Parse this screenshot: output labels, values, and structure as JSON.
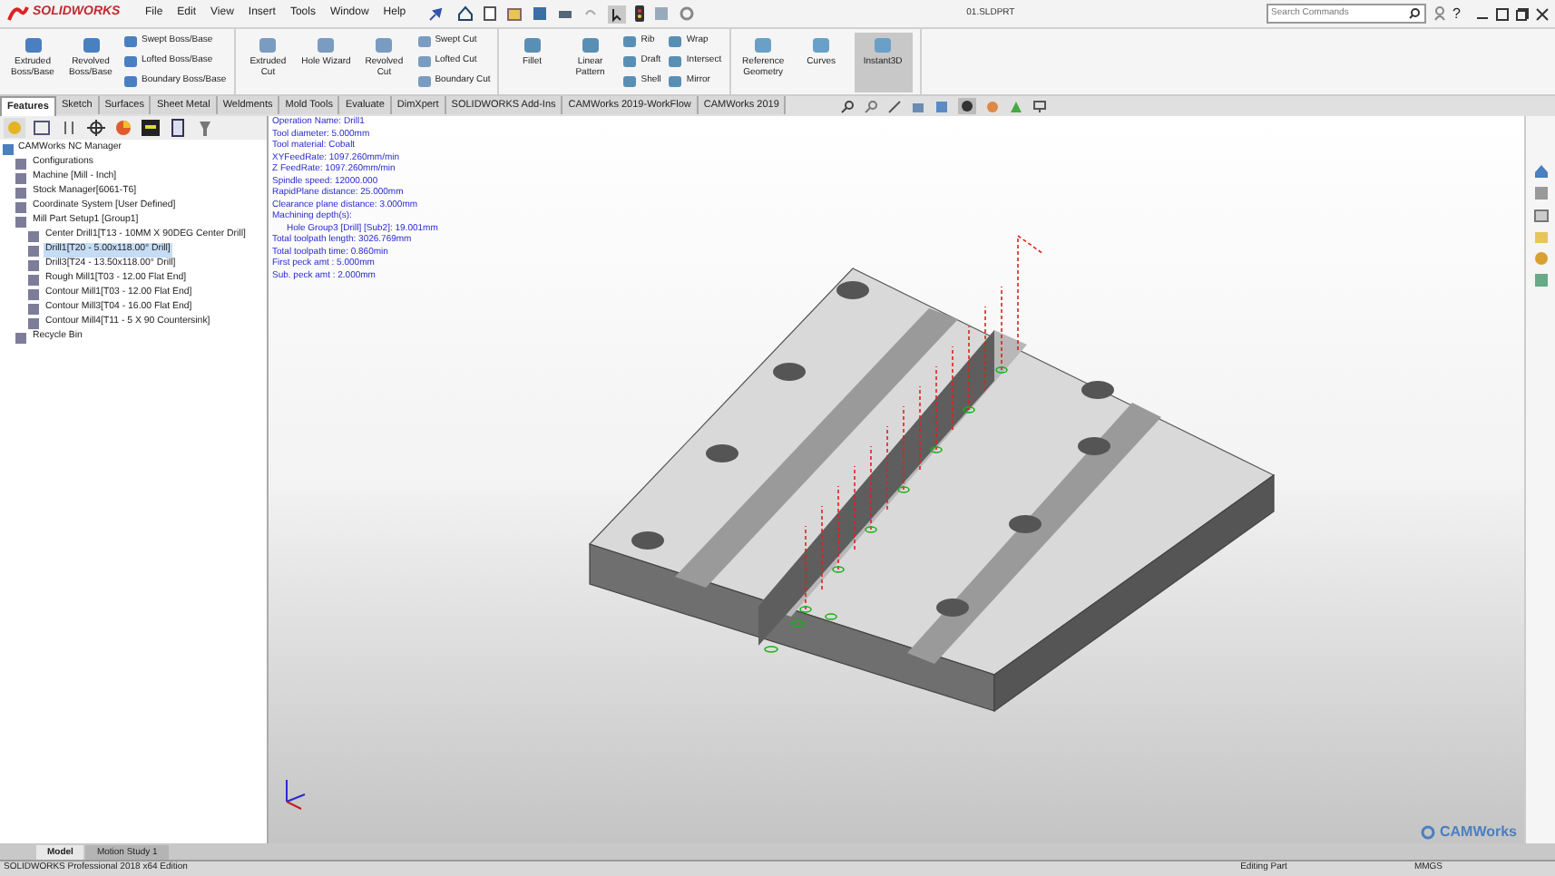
{
  "app": {
    "logo": "SOLIDWORKS",
    "menus": [
      "File",
      "Edit",
      "View",
      "Insert",
      "Tools",
      "Window",
      "Help"
    ],
    "document_title": "01.SLDPRT",
    "search": {
      "placeholder": "Search Commands"
    },
    "help": "?"
  },
  "ribbon": {
    "groups": [
      {
        "items": [
          {
            "kind": "large",
            "label": "Extruded Boss/Base",
            "on": false
          },
          {
            "kind": "large",
            "label": "Revolved Boss/Base",
            "on": false
          },
          {
            "kind": "stack",
            "labels": [
              "Swept Boss/Base",
              "Lofted Boss/Base",
              "Boundary Boss/Base"
            ]
          }
        ]
      },
      {
        "items": [
          {
            "kind": "large",
            "label": "Extruded Cut",
            "on": false
          },
          {
            "kind": "large",
            "label": "Hole Wizard",
            "on": false
          },
          {
            "kind": "large",
            "label": "Revolved Cut",
            "on": false
          },
          {
            "kind": "stack",
            "labels": [
              "Swept Cut",
              "Lofted Cut",
              "Boundary Cut"
            ]
          }
        ]
      },
      {
        "items": [
          {
            "kind": "large",
            "label": "Fillet",
            "on": false
          },
          {
            "kind": "large",
            "label": "Linear Pattern",
            "on": false
          },
          {
            "kind": "stack",
            "labels": [
              "Rib",
              "Draft",
              "Shell"
            ]
          },
          {
            "kind": "stack",
            "labels": [
              "Wrap",
              "Intersect",
              "Mirror"
            ]
          }
        ]
      },
      {
        "items": [
          {
            "kind": "large",
            "label": "Reference Geometry",
            "on": false
          },
          {
            "kind": "large",
            "label": "Curves",
            "on": false
          },
          {
            "kind": "large",
            "label": "Instant3D",
            "on": true
          }
        ]
      }
    ]
  },
  "tabs": [
    {
      "label": "Features",
      "selected": true
    },
    {
      "label": "Sketch",
      "selected": false
    },
    {
      "label": "Surfaces",
      "selected": false
    },
    {
      "label": "Sheet Metal",
      "selected": false
    },
    {
      "label": "Weldments",
      "selected": false
    },
    {
      "label": "Mold Tools",
      "selected": false
    },
    {
      "label": "Evaluate",
      "selected": false
    },
    {
      "label": "DimXpert",
      "selected": false
    },
    {
      "label": "SOLIDWORKS Add-Ins",
      "selected": false
    },
    {
      "label": "CAMWorks 2019-WorkFlow",
      "selected": false
    },
    {
      "label": "CAMWorks 2019",
      "selected": false
    }
  ],
  "tree": {
    "label": "CAMWorks NC Manager",
    "children": [
      {
        "label": "Configurations",
        "selected": false
      },
      {
        "label": "Machine [Mill - Inch]",
        "selected": false
      },
      {
        "label": "Stock Manager[6061-T6]",
        "selected": false
      },
      {
        "label": "Coordinate System [User Defined]",
        "selected": false
      },
      {
        "label": "Mill Part Setup1 [Group1]",
        "selected": false,
        "children": [
          {
            "label": "Center Drill1[T13 - 10MM X 90DEG Center Drill]",
            "selected": false
          },
          {
            "label": "Drill1[T20 - 5.00x118.00° Drill]",
            "selected": true
          },
          {
            "label": "Drill3[T24 - 13.50x118.00° Drill]",
            "selected": false
          },
          {
            "label": "Rough Mill1[T03 - 12.00 Flat End]",
            "selected": false
          },
          {
            "label": "Contour Mill1[T03 - 12.00 Flat End]",
            "selected": false
          },
          {
            "label": "Contour Mill3[T04 - 16.00 Flat End]",
            "selected": false
          },
          {
            "label": "Contour Mill4[T11 - 5 X 90 Countersink]",
            "selected": false
          }
        ]
      },
      {
        "label": "Recycle Bin",
        "selected": false
      }
    ]
  },
  "operation_info": [
    {
      "kind": "line",
      "text": "Operation Name: Drill1"
    },
    {
      "kind": "line",
      "text": "Tool diameter: 5.000mm"
    },
    {
      "kind": "line",
      "text": "Tool material: Cobalt"
    },
    {
      "kind": "line",
      "text": "XYFeedRate: 1097.260mm/min"
    },
    {
      "kind": "line",
      "text": "Z FeedRate: 1097.260mm/min"
    },
    {
      "kind": "line",
      "text": "Spindle speed: 12000.000"
    },
    {
      "kind": "line",
      "text": "RapidPlane distance: 25.000mm"
    },
    {
      "kind": "line",
      "text": "Clearance plane distance: 3.000mm"
    },
    {
      "kind": "line",
      "text": "Machining depth(s):"
    },
    {
      "kind": "sub",
      "text": "Hole Group3 [Drill] [Sub2]: 19.001mm"
    },
    {
      "kind": "line",
      "text": "Total toolpath length: 3026.769mm"
    },
    {
      "kind": "line",
      "text": "Total toolpath time: 0.860min"
    },
    {
      "kind": "line",
      "text": "First peck amt : 5.000mm"
    },
    {
      "kind": "line",
      "text": "Sub. peck amt : 2.000mm"
    }
  ],
  "viewport_logo": "CAMWorks",
  "bottom_tabs": [
    {
      "label": "Model",
      "selected": true
    },
    {
      "label": "Motion Study 1",
      "selected": false
    }
  ],
  "status_bar": {
    "edition": "SOLIDWORKS Professional 2018 x64 Edition",
    "mode": "Editing Part",
    "units": "MMGS"
  }
}
